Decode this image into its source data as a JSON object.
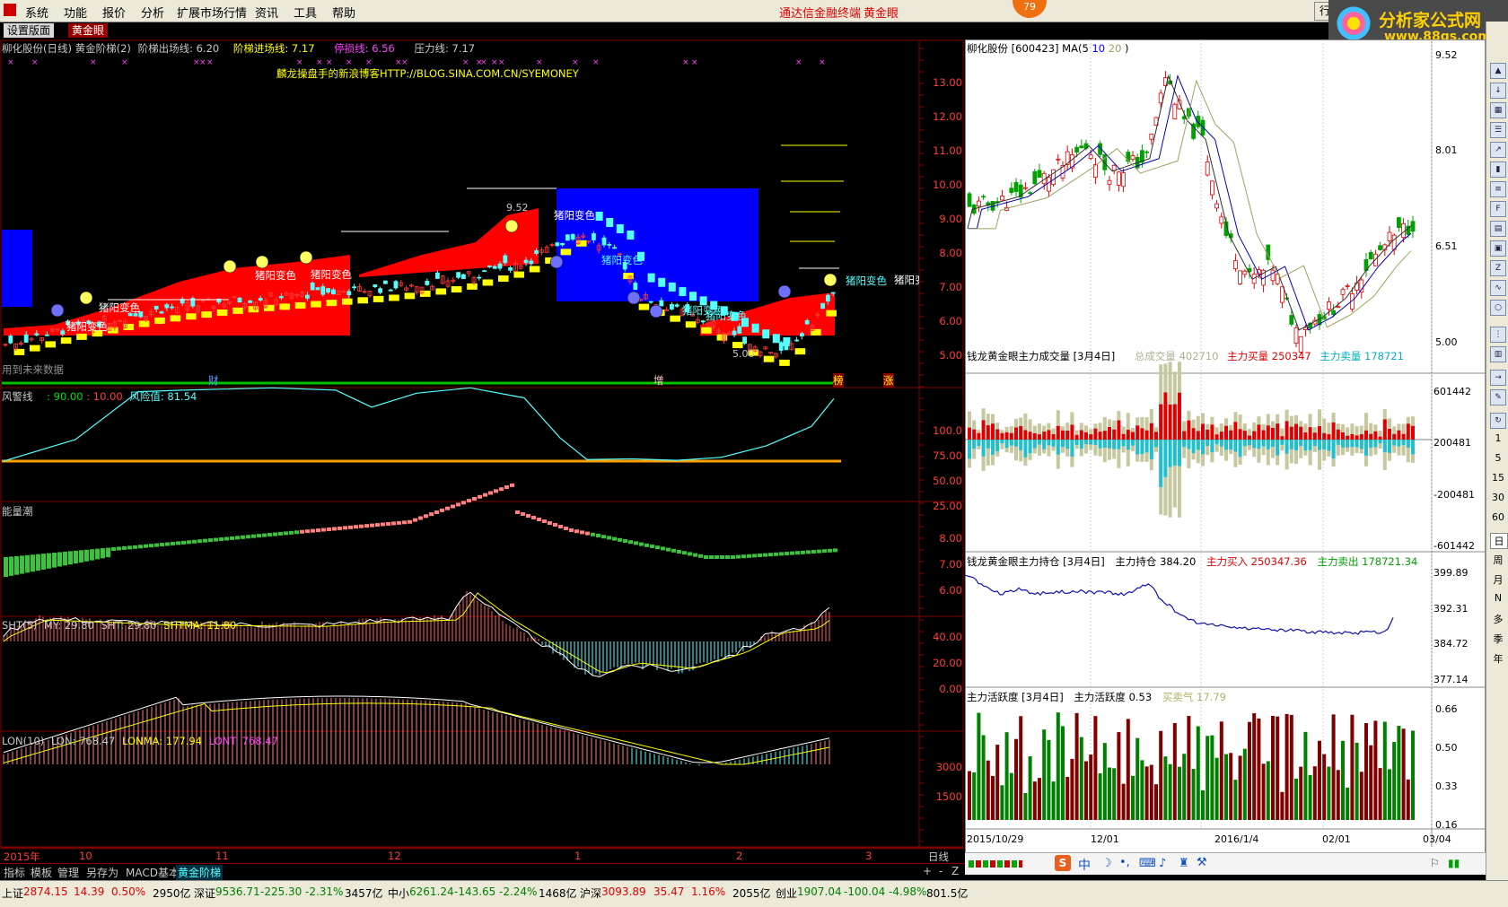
{
  "menubar": {
    "items": [
      "系统",
      "功能",
      "报价",
      "分析",
      "扩展市场行情",
      "资讯",
      "工具",
      "帮助"
    ],
    "center_title": "通达信金融终端",
    "center_sub": "黄金眼",
    "badge": "79",
    "right_btn": "行",
    "logo_line1": "分析家公式网",
    "logo_line2": "www.88gs.com"
  },
  "tabs": {
    "settings": "设置版面",
    "active": "黄金眼"
  },
  "main": {
    "title_stock": "柳化股份(日线) 黄金阶梯(2)",
    "title_exit": "阶梯出场线: 6.20",
    "title_entry": "阶梯进场线: 7.17",
    "title_stop": "停损线: 6.56",
    "title_press": "压力线: 7.17",
    "blog": "麟龙操盘手的新浪博客HTTP://BLOG.SINA.COM.CN/SYEMONEY",
    "future_note": "用到未来数据",
    "high_label": "9.52",
    "low_label": "5.00",
    "signal_label": "猪阳变色",
    "markers": [
      "财",
      "增",
      "榜",
      "涨"
    ],
    "y_axis": [
      "13.00",
      "12.00",
      "11.00",
      "10.00",
      "9.00",
      "8.00",
      "7.00",
      "6.00",
      "5.00"
    ]
  },
  "risk": {
    "title": "风警线",
    "v1": ": 90.00",
    "v2": ": 10.00",
    "v3": "风险值: 81.54",
    "y_axis": [
      "100.0",
      "75.00",
      "50.00",
      "25.00"
    ]
  },
  "energy": {
    "title": "能量潮",
    "y_axis": [
      "8.00",
      "7.00",
      "6.00"
    ]
  },
  "sht": {
    "title": "SHT(5)",
    "my": "MY: 29.80",
    "sht": "SHT: 29.80",
    "shtma": "SHTMA: 11.80",
    "y_axis": [
      "40.00",
      "20.00",
      "0.00"
    ]
  },
  "lon": {
    "title": "LON(10)",
    "lon": "LON: 768.47",
    "lonma": "LONMA: 177.94",
    "lont": "LONT: 768.47",
    "y_axis": [
      "3000",
      "1500"
    ]
  },
  "date_axis": {
    "labels": [
      "2015年",
      "10",
      "11",
      "12",
      "1",
      "2",
      "3"
    ],
    "period": "日线"
  },
  "right": {
    "p1": {
      "title": "柳化股份  [600423] MA(",
      "m1": "5",
      "m2": "10",
      "m3": "20",
      "close": ")",
      "y": [
        "9.52",
        "8.01",
        "6.51",
        "5.00"
      ]
    },
    "p2": {
      "title": "钱龙黄金眼主力成交量 [3月4日]",
      "a": "总成交量",
      "av": "402710",
      "b": "主力买量",
      "bv": "250347",
      "c": "主力卖量",
      "cv": "178721",
      "y": [
        "601442",
        "200481",
        "-200481",
        "-601442"
      ]
    },
    "p3": {
      "title": "钱龙黄金眼主力持仓 [3月4日]",
      "a": "主力持仓",
      "av": "384.20",
      "b": "主力买入",
      "bv": "250347.36",
      "c": "主力卖出",
      "cv": "178721.34",
      "y": [
        "399.89",
        "392.31",
        "384.72",
        "377.14"
      ]
    },
    "p4": {
      "title": "主力活跃度 [3月4日]",
      "a": "主力活跃度",
      "av": "0.53",
      "b": "买卖气",
      "bv": "17.79",
      "y": [
        "0.66",
        "0.50",
        "0.33",
        "0.16"
      ]
    },
    "x": [
      "2015/10/29",
      "12/01",
      "2016/1/4",
      "02/01",
      "03/04"
    ]
  },
  "sidebar_periods": [
    "1",
    "5",
    "15",
    "30",
    "60",
    "日",
    "周",
    "月",
    "N",
    "多",
    "季",
    "年"
  ],
  "bottom_tabs": [
    "指标",
    "模板",
    "管理",
    "另存为",
    "MACD基本",
    "黄金阶梯"
  ],
  "bottom_controls": [
    "+",
    "-",
    "Z"
  ],
  "status": {
    "sh": {
      "name": "上证",
      "val": "2874.15",
      "chg": "14.39",
      "pct": "0.50%",
      "amt": "2950亿"
    },
    "sz": {
      "name": "深证",
      "val": "9536.71",
      "chg": "-225.30",
      "pct": "-2.31%",
      "amt": "3457亿"
    },
    "zx": {
      "name": "中小",
      "val": "6261.24",
      "chg": "-143.65",
      "pct": "-2.24%",
      "amt": "1468亿"
    },
    "hs": {
      "name": "沪深",
      "val": "3093.89",
      "chg": "35.47",
      "pct": "1.16%",
      "amt": "2055亿"
    },
    "cy": {
      "name": "创业",
      "val": "1907.04",
      "chg": "-100.04",
      "pct": "-4.98%",
      "amt": "801.5亿"
    },
    "ime": "中"
  },
  "colors": {
    "up": "#ff3c3c",
    "down": "#54ffff",
    "yellow": "#ffff00",
    "blue": "#0000ff",
    "magenta": "#ff40ff",
    "green": "#00c000"
  }
}
